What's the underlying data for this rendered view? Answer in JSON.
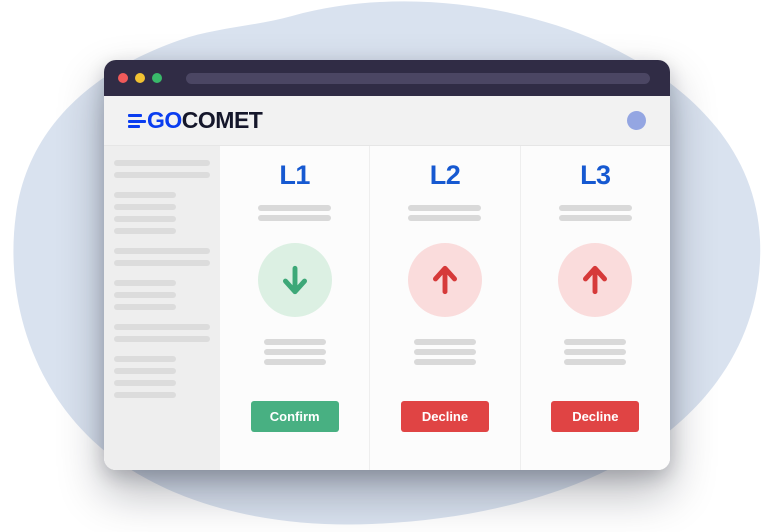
{
  "background": {
    "blob_color": "#d9e2ef"
  },
  "window": {
    "titlebar": {
      "dots": [
        {
          "name": "close-dot",
          "color": "#f05a5a"
        },
        {
          "name": "minimize-dot",
          "color": "#f1c232"
        },
        {
          "name": "maximize-dot",
          "color": "#39b96a"
        }
      ],
      "urlbar_value": "",
      "bar_color": "#302c45"
    },
    "header": {
      "logo_go": "GO",
      "logo_comet": "COMET",
      "logo_accent_color": "#0a3df0",
      "logo_text_color": "#15172b",
      "avatar_color": "#94a6e2"
    },
    "sidebar": {
      "groups": [
        {
          "bars": [
            "wide",
            "wide"
          ]
        },
        {
          "bars": [
            "mid",
            "mid",
            "mid",
            "mid"
          ]
        },
        {
          "bars": [
            "wide",
            "wide"
          ]
        },
        {
          "bars": [
            "mid",
            "mid",
            "mid"
          ]
        },
        {
          "bars": [
            "wide",
            "wide"
          ]
        },
        {
          "bars": [
            "mid",
            "mid",
            "mid",
            "mid"
          ]
        }
      ]
    },
    "columns": [
      {
        "title": "L1",
        "arrow_icon": "arrow-down-icon",
        "arrow_direction": "down",
        "circle_color": "#dcf0e3",
        "arrow_color": "#3da878",
        "button_label": "Confirm",
        "button_color": "#48b082",
        "button_variant": "confirm",
        "top_bars": 2,
        "bottom_bars": 3
      },
      {
        "title": "L2",
        "arrow_icon": "arrow-up-icon",
        "arrow_direction": "up",
        "circle_color": "#fadcdc",
        "arrow_color": "#d63a3a",
        "button_label": "Decline",
        "button_color": "#e04444",
        "button_variant": "decline",
        "top_bars": 2,
        "bottom_bars": 3
      },
      {
        "title": "L3",
        "arrow_icon": "arrow-up-icon",
        "arrow_direction": "up",
        "circle_color": "#fadcdc",
        "arrow_color": "#d63a3a",
        "button_label": "Decline",
        "button_color": "#e04444",
        "button_variant": "decline",
        "top_bars": 2,
        "bottom_bars": 3
      }
    ]
  }
}
